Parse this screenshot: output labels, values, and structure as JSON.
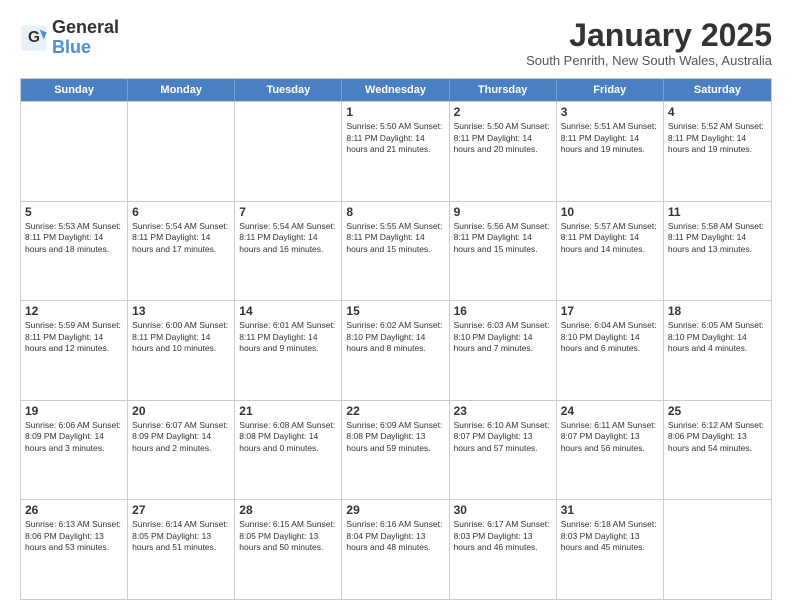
{
  "logo": {
    "line1": "General",
    "line2": "Blue"
  },
  "title": "January 2025",
  "subtitle": "South Penrith, New South Wales, Australia",
  "header_days": [
    "Sunday",
    "Monday",
    "Tuesday",
    "Wednesday",
    "Thursday",
    "Friday",
    "Saturday"
  ],
  "weeks": [
    [
      {
        "day": "",
        "info": ""
      },
      {
        "day": "",
        "info": ""
      },
      {
        "day": "",
        "info": ""
      },
      {
        "day": "1",
        "info": "Sunrise: 5:50 AM\nSunset: 8:11 PM\nDaylight: 14 hours\nand 21 minutes."
      },
      {
        "day": "2",
        "info": "Sunrise: 5:50 AM\nSunset: 8:11 PM\nDaylight: 14 hours\nand 20 minutes."
      },
      {
        "day": "3",
        "info": "Sunrise: 5:51 AM\nSunset: 8:11 PM\nDaylight: 14 hours\nand 19 minutes."
      },
      {
        "day": "4",
        "info": "Sunrise: 5:52 AM\nSunset: 8:11 PM\nDaylight: 14 hours\nand 19 minutes."
      }
    ],
    [
      {
        "day": "5",
        "info": "Sunrise: 5:53 AM\nSunset: 8:11 PM\nDaylight: 14 hours\nand 18 minutes."
      },
      {
        "day": "6",
        "info": "Sunrise: 5:54 AM\nSunset: 8:11 PM\nDaylight: 14 hours\nand 17 minutes."
      },
      {
        "day": "7",
        "info": "Sunrise: 5:54 AM\nSunset: 8:11 PM\nDaylight: 14 hours\nand 16 minutes."
      },
      {
        "day": "8",
        "info": "Sunrise: 5:55 AM\nSunset: 8:11 PM\nDaylight: 14 hours\nand 15 minutes."
      },
      {
        "day": "9",
        "info": "Sunrise: 5:56 AM\nSunset: 8:11 PM\nDaylight: 14 hours\nand 15 minutes."
      },
      {
        "day": "10",
        "info": "Sunrise: 5:57 AM\nSunset: 8:11 PM\nDaylight: 14 hours\nand 14 minutes."
      },
      {
        "day": "11",
        "info": "Sunrise: 5:58 AM\nSunset: 8:11 PM\nDaylight: 14 hours\nand 13 minutes."
      }
    ],
    [
      {
        "day": "12",
        "info": "Sunrise: 5:59 AM\nSunset: 8:11 PM\nDaylight: 14 hours\nand 12 minutes."
      },
      {
        "day": "13",
        "info": "Sunrise: 6:00 AM\nSunset: 8:11 PM\nDaylight: 14 hours\nand 10 minutes."
      },
      {
        "day": "14",
        "info": "Sunrise: 6:01 AM\nSunset: 8:11 PM\nDaylight: 14 hours\nand 9 minutes."
      },
      {
        "day": "15",
        "info": "Sunrise: 6:02 AM\nSunset: 8:10 PM\nDaylight: 14 hours\nand 8 minutes."
      },
      {
        "day": "16",
        "info": "Sunrise: 6:03 AM\nSunset: 8:10 PM\nDaylight: 14 hours\nand 7 minutes."
      },
      {
        "day": "17",
        "info": "Sunrise: 6:04 AM\nSunset: 8:10 PM\nDaylight: 14 hours\nand 6 minutes."
      },
      {
        "day": "18",
        "info": "Sunrise: 6:05 AM\nSunset: 8:10 PM\nDaylight: 14 hours\nand 4 minutes."
      }
    ],
    [
      {
        "day": "19",
        "info": "Sunrise: 6:06 AM\nSunset: 8:09 PM\nDaylight: 14 hours\nand 3 minutes."
      },
      {
        "day": "20",
        "info": "Sunrise: 6:07 AM\nSunset: 8:09 PM\nDaylight: 14 hours\nand 2 minutes."
      },
      {
        "day": "21",
        "info": "Sunrise: 6:08 AM\nSunset: 8:08 PM\nDaylight: 14 hours\nand 0 minutes."
      },
      {
        "day": "22",
        "info": "Sunrise: 6:09 AM\nSunset: 8:08 PM\nDaylight: 13 hours\nand 59 minutes."
      },
      {
        "day": "23",
        "info": "Sunrise: 6:10 AM\nSunset: 8:07 PM\nDaylight: 13 hours\nand 57 minutes."
      },
      {
        "day": "24",
        "info": "Sunrise: 6:11 AM\nSunset: 8:07 PM\nDaylight: 13 hours\nand 56 minutes."
      },
      {
        "day": "25",
        "info": "Sunrise: 6:12 AM\nSunset: 8:06 PM\nDaylight: 13 hours\nand 54 minutes."
      }
    ],
    [
      {
        "day": "26",
        "info": "Sunrise: 6:13 AM\nSunset: 8:06 PM\nDaylight: 13 hours\nand 53 minutes."
      },
      {
        "day": "27",
        "info": "Sunrise: 6:14 AM\nSunset: 8:05 PM\nDaylight: 13 hours\nand 51 minutes."
      },
      {
        "day": "28",
        "info": "Sunrise: 6:15 AM\nSunset: 8:05 PM\nDaylight: 13 hours\nand 50 minutes."
      },
      {
        "day": "29",
        "info": "Sunrise: 6:16 AM\nSunset: 8:04 PM\nDaylight: 13 hours\nand 48 minutes."
      },
      {
        "day": "30",
        "info": "Sunrise: 6:17 AM\nSunset: 8:03 PM\nDaylight: 13 hours\nand 46 minutes."
      },
      {
        "day": "31",
        "info": "Sunrise: 6:18 AM\nSunset: 8:03 PM\nDaylight: 13 hours\nand 45 minutes."
      },
      {
        "day": "",
        "info": ""
      }
    ]
  ]
}
